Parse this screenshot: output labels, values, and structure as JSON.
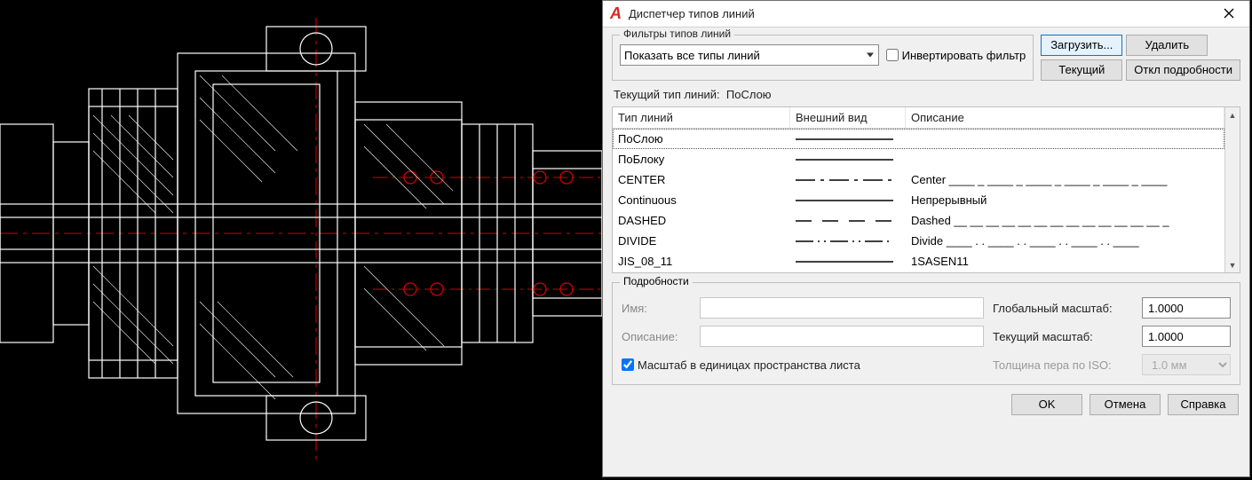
{
  "dialog": {
    "title": "Диспетчер типов линий",
    "filters": {
      "legend": "Фильтры типов линий",
      "selected": "Показать все типы линий",
      "invert_label": "Инвертировать фильтр"
    },
    "buttons": {
      "load": "Загрузить...",
      "delete": "Удалить",
      "current": "Текущий",
      "toggle_details": "Откл подробности"
    },
    "current_line_label": "Текущий тип линий:",
    "current_line_value": "ПоСлою",
    "columns": {
      "name": "Тип линий",
      "appearance": "Внешний вид",
      "description": "Описание"
    },
    "rows": [
      {
        "name": "ПоСлою",
        "pattern": "solid",
        "desc": ""
      },
      {
        "name": "ПоБлоку",
        "pattern": "solid",
        "desc": ""
      },
      {
        "name": "CENTER",
        "pattern": "center",
        "desc": "Center ____ _ ____ _ ____ _ ____ _ ____ _ ____"
      },
      {
        "name": "Continuous",
        "pattern": "solid",
        "desc": "Непрерывный"
      },
      {
        "name": "DASHED",
        "pattern": "dashed",
        "desc": "Dashed __ __ __ __ __ __ __ __ __ __ __ __ __ _"
      },
      {
        "name": "DIVIDE",
        "pattern": "divide",
        "desc": "Divide ____ . . ____ . . ____ . . ____ . . ____"
      },
      {
        "name": "JIS_08_11",
        "pattern": "solid",
        "desc": "1SASEN11"
      }
    ],
    "selected_row": 0,
    "details": {
      "legend": "Подробности",
      "name_label": "Имя:",
      "desc_label": "Описание:",
      "name_value": "",
      "desc_value": "",
      "scale_chk": "Масштаб в единицах пространства листа",
      "global_scale_label": "Глобальный масштаб:",
      "global_scale_value": "1.0000",
      "current_scale_label": "Текущий масштаб:",
      "current_scale_value": "1.0000",
      "pen_label": "Толщина пера по ISO:",
      "pen_value": "1.0 мм"
    },
    "footer": {
      "ok": "OK",
      "cancel": "Отмена",
      "help": "Справка"
    }
  }
}
